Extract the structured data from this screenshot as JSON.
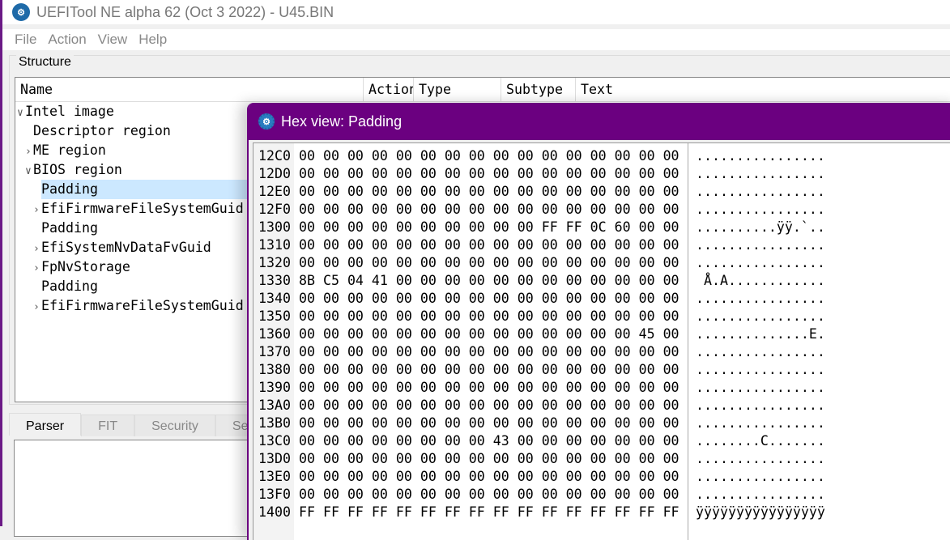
{
  "window": {
    "title": "UEFITool NE alpha 62 (Oct  3 2022) - U45.BIN",
    "icon": "uefitool-gear-icon"
  },
  "menu": [
    "File",
    "Action",
    "View",
    "Help"
  ],
  "structure": {
    "label": "Structure",
    "columns": [
      "Name",
      "Action",
      "Type",
      "Subtype",
      "Text"
    ],
    "rows": [
      {
        "label": "Intel image",
        "depth": 0,
        "expander": "expanded"
      },
      {
        "label": "Descriptor region",
        "depth": 1,
        "expander": "none"
      },
      {
        "label": "ME region",
        "depth": 1,
        "expander": "collapsed"
      },
      {
        "label": "BIOS region",
        "depth": 1,
        "expander": "expanded"
      },
      {
        "label": "Padding",
        "depth": 2,
        "expander": "none",
        "selected": true
      },
      {
        "label": "EfiFirmwareFileSystemGuid",
        "depth": 2,
        "expander": "collapsed"
      },
      {
        "label": "Padding",
        "depth": 2,
        "expander": "none"
      },
      {
        "label": "EfiSystemNvDataFvGuid",
        "depth": 2,
        "expander": "collapsed"
      },
      {
        "label": "FpNvStorage",
        "depth": 2,
        "expander": "collapsed"
      },
      {
        "label": "Padding",
        "depth": 2,
        "expander": "none"
      },
      {
        "label": "EfiFirmwareFileSystemGuid",
        "depth": 2,
        "expander": "collapsed"
      }
    ]
  },
  "bottom_tabs": [
    "Parser",
    "FIT",
    "Security",
    "Search"
  ],
  "hex_view": {
    "title": "Hex view: Padding",
    "rows": [
      {
        "addr": "12C0",
        "bytes": "00 00 00 00 00 00 00 00 00 00 00 00 00 00 00 00",
        "ascii": "................"
      },
      {
        "addr": "12D0",
        "bytes": "00 00 00 00 00 00 00 00 00 00 00 00 00 00 00 00",
        "ascii": "................"
      },
      {
        "addr": "12E0",
        "bytes": "00 00 00 00 00 00 00 00 00 00 00 00 00 00 00 00",
        "ascii": "................"
      },
      {
        "addr": "12F0",
        "bytes": "00 00 00 00 00 00 00 00 00 00 00 00 00 00 00 00",
        "ascii": "................"
      },
      {
        "addr": "1300",
        "bytes": "00 00 00 00 00 00 00 00 00 00 FF FF 0C 60 00 00",
        "ascii": "..........ÿÿ.`.."
      },
      {
        "addr": "1310",
        "bytes": "00 00 00 00 00 00 00 00 00 00 00 00 00 00 00 00",
        "ascii": "................"
      },
      {
        "addr": "1320",
        "bytes": "00 00 00 00 00 00 00 00 00 00 00 00 00 00 00 00",
        "ascii": "................"
      },
      {
        "addr": "1330",
        "bytes": "8B C5 04 41 00 00 00 00 00 00 00 00 00 00 00 00",
        "ascii": " Å.A............"
      },
      {
        "addr": "1340",
        "bytes": "00 00 00 00 00 00 00 00 00 00 00 00 00 00 00 00",
        "ascii": "................"
      },
      {
        "addr": "1350",
        "bytes": "00 00 00 00 00 00 00 00 00 00 00 00 00 00 00 00",
        "ascii": "................"
      },
      {
        "addr": "1360",
        "bytes": "00 00 00 00 00 00 00 00 00 00 00 00 00 00 45 00",
        "ascii": "..............E."
      },
      {
        "addr": "1370",
        "bytes": "00 00 00 00 00 00 00 00 00 00 00 00 00 00 00 00",
        "ascii": "................"
      },
      {
        "addr": "1380",
        "bytes": "00 00 00 00 00 00 00 00 00 00 00 00 00 00 00 00",
        "ascii": "................"
      },
      {
        "addr": "1390",
        "bytes": "00 00 00 00 00 00 00 00 00 00 00 00 00 00 00 00",
        "ascii": "................"
      },
      {
        "addr": "13A0",
        "bytes": "00 00 00 00 00 00 00 00 00 00 00 00 00 00 00 00",
        "ascii": "................"
      },
      {
        "addr": "13B0",
        "bytes": "00 00 00 00 00 00 00 00 00 00 00 00 00 00 00 00",
        "ascii": "................"
      },
      {
        "addr": "13C0",
        "bytes": "00 00 00 00 00 00 00 00 43 00 00 00 00 00 00 00",
        "ascii": "........C......."
      },
      {
        "addr": "13D0",
        "bytes": "00 00 00 00 00 00 00 00 00 00 00 00 00 00 00 00",
        "ascii": "................"
      },
      {
        "addr": "13E0",
        "bytes": "00 00 00 00 00 00 00 00 00 00 00 00 00 00 00 00",
        "ascii": "................"
      },
      {
        "addr": "13F0",
        "bytes": "00 00 00 00 00 00 00 00 00 00 00 00 00 00 00 00",
        "ascii": "................"
      },
      {
        "addr": "1400",
        "bytes": "FF FF FF FF FF FF FF FF FF FF FF FF FF FF FF FF",
        "ascii": "ÿÿÿÿÿÿÿÿÿÿÿÿÿÿÿÿ"
      }
    ]
  },
  "colors": {
    "accent": "#6b0080",
    "selection": "#cce8ff"
  }
}
